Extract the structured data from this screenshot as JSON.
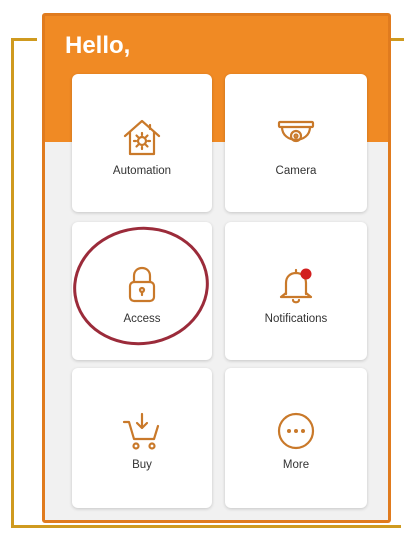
{
  "header": {
    "greeting": "Hello,"
  },
  "tiles": [
    {
      "label": "Automation",
      "icon": "home-gear-icon"
    },
    {
      "label": "Camera",
      "icon": "security-camera-icon"
    },
    {
      "label": "Access",
      "icon": "lock-icon"
    },
    {
      "label": "Notifications",
      "icon": "bell-icon"
    },
    {
      "label": "Buy",
      "icon": "shopping-cart-icon"
    },
    {
      "label": "More",
      "icon": "more-icon"
    }
  ],
  "colors": {
    "header": "#f08a24",
    "icon_stroke": "#c9792a",
    "notification_dot": "#d21f1f",
    "highlight_circle": "#9b2b3a",
    "frame": "#cf9a1f"
  }
}
